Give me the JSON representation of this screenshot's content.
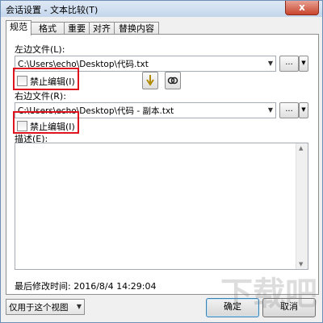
{
  "window": {
    "title": "会话设置 - 文本比较(T)",
    "close_symbol": "x"
  },
  "tabs": [
    {
      "label": "规范",
      "active": true
    },
    {
      "label": "格式",
      "active": false
    },
    {
      "label": "重要",
      "active": false
    },
    {
      "label": "对齐",
      "active": false
    },
    {
      "label": "替换内容",
      "active": false
    }
  ],
  "left_file": {
    "label": "左边文件(L):",
    "value": "C:\\Users\\echo\\Desktop\\代码.txt",
    "browse_label": "...",
    "lock_label": "禁止编辑(I)",
    "lock_checked": false
  },
  "right_file": {
    "label": "右边文件(R):",
    "value": "C:\\Users\\echo\\Desktop\\代码 - 副本.txt",
    "browse_label": "...",
    "lock_label": "禁止编辑(I)",
    "lock_checked": false
  },
  "description": {
    "label": "描述(E):",
    "value": ""
  },
  "modified": {
    "text": "最后修改时间: 2016/8/4 14:29:04"
  },
  "footer": {
    "scope_select": "仅用于这个视图",
    "ok_label": "确定",
    "cancel_label": "取消"
  },
  "watermark": {
    "text": "下载吧"
  },
  "colors": {
    "highlight_box": "#e0141e",
    "window_border": "#6d8fb5",
    "close_button": "#c9452d"
  }
}
